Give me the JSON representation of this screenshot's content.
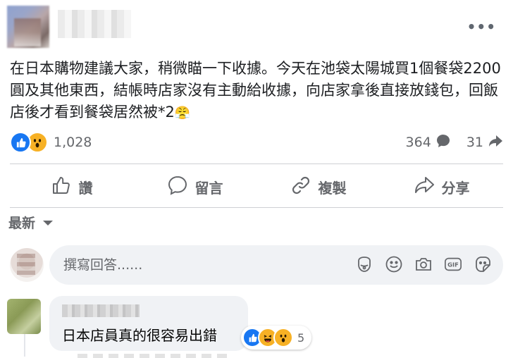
{
  "post": {
    "more_label": "•••",
    "text": "在日本購物建議大家，稍微瞄一下收據。今天在池袋太陽城買1個餐袋2200圓及其他東西，結帳時店家沒有主動給收據，向店家拿後直接放錢包，回飯店後才看到餐袋居然被*2",
    "emoji": "😤"
  },
  "stats": {
    "reaction_count": "1,028",
    "comment_count": "364",
    "share_count": "31",
    "reaction_types": [
      "like-icon",
      "wow-icon"
    ]
  },
  "actions": [
    {
      "label": "讚",
      "icon": "thumbs-up-icon"
    },
    {
      "label": "留言",
      "icon": "comment-bubble-icon"
    },
    {
      "label": "複製",
      "icon": "link-icon"
    },
    {
      "label": "分享",
      "icon": "share-arrow-icon"
    }
  ],
  "sort": {
    "label": "最新",
    "icon": "caret-down-icon"
  },
  "composer": {
    "placeholder": "撰寫回答......",
    "icons": [
      "avatar-sticker-icon",
      "emoji-icon",
      "camera-icon",
      "gif-icon",
      "sticker-icon"
    ]
  },
  "comment": {
    "text": "日本店員真的很容易出錯",
    "reaction_count": "5",
    "reaction_types": [
      "like-icon",
      "haha-icon",
      "wow-icon"
    ]
  },
  "colors": {
    "like_blue": "#1877f2",
    "wow_yellow": "#f7b125",
    "secondary_text": "#65676b",
    "bubble_bg": "#f0f2f5"
  }
}
